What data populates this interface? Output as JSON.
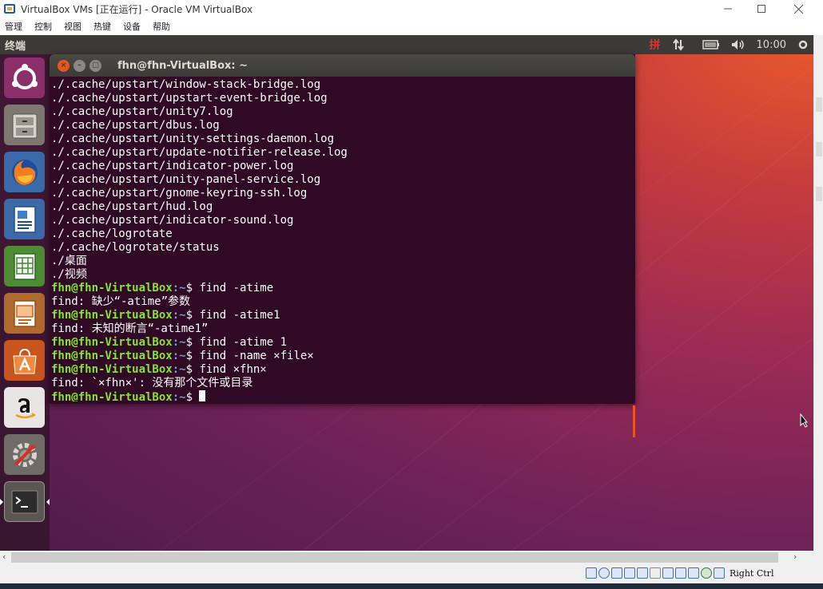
{
  "host": {
    "title": "VirtualBox VMs [正在运行] - Oracle VM VirtualBox",
    "menu": [
      "管理",
      "控制",
      "视图",
      "热键",
      "设备",
      "帮助"
    ],
    "host_key": "Right Ctrl"
  },
  "guest_panel": {
    "app_name": "终端",
    "input_method": "拼",
    "clock": "10:00"
  },
  "launcher": {
    "items": [
      {
        "name": "ubuntu-dash-icon"
      },
      {
        "name": "files-icon"
      },
      {
        "name": "firefox-icon"
      },
      {
        "name": "libreoffice-writer-icon"
      },
      {
        "name": "libreoffice-calc-icon"
      },
      {
        "name": "libreoffice-impress-icon"
      },
      {
        "name": "software-center-icon"
      },
      {
        "name": "amazon-icon"
      },
      {
        "name": "system-settings-icon"
      },
      {
        "name": "terminal-icon"
      }
    ]
  },
  "terminal": {
    "title": "fhn@fhn-VirtualBox: ~",
    "prompt_user": "fhn@fhn-VirtualBox",
    "prompt_path": ":~",
    "prompt_sign": "$",
    "lines": [
      {
        "type": "out",
        "text": "./.cache/upstart/window-stack-bridge.log"
      },
      {
        "type": "out",
        "text": "./.cache/upstart/upstart-event-bridge.log"
      },
      {
        "type": "out",
        "text": "./.cache/upstart/unity7.log"
      },
      {
        "type": "out",
        "text": "./.cache/upstart/dbus.log"
      },
      {
        "type": "out",
        "text": "./.cache/upstart/unity-settings-daemon.log"
      },
      {
        "type": "out",
        "text": "./.cache/upstart/update-notifier-release.log"
      },
      {
        "type": "out",
        "text": "./.cache/upstart/indicator-power.log"
      },
      {
        "type": "out",
        "text": "./.cache/upstart/unity-panel-service.log"
      },
      {
        "type": "out",
        "text": "./.cache/upstart/gnome-keyring-ssh.log"
      },
      {
        "type": "out",
        "text": "./.cache/upstart/hud.log"
      },
      {
        "type": "out",
        "text": "./.cache/upstart/indicator-sound.log"
      },
      {
        "type": "out",
        "text": "./.cache/logrotate"
      },
      {
        "type": "out",
        "text": "./.cache/logrotate/status"
      },
      {
        "type": "out",
        "text": "./桌面"
      },
      {
        "type": "out",
        "text": "./视频"
      },
      {
        "type": "cmd",
        "text": " find -atime"
      },
      {
        "type": "out",
        "text": "find: 缺少“-atime”参数"
      },
      {
        "type": "cmd",
        "text": " find -atime1"
      },
      {
        "type": "out",
        "text": "find: 未知的断言“-atime1”"
      },
      {
        "type": "cmd",
        "text": " find -atime 1"
      },
      {
        "type": "cmd",
        "text": " find -name ×file×"
      },
      {
        "type": "cmd",
        "text": " find ×fhn×"
      },
      {
        "type": "out",
        "text": "find: `×fhn×': 没有那个文件或目录"
      },
      {
        "type": "cursor",
        "text": " "
      }
    ]
  },
  "colors": {
    "terminal_bg": "#300a24",
    "prompt_user": "#8ae234",
    "prompt_path": "#729fcf",
    "accent": "#e95420"
  }
}
